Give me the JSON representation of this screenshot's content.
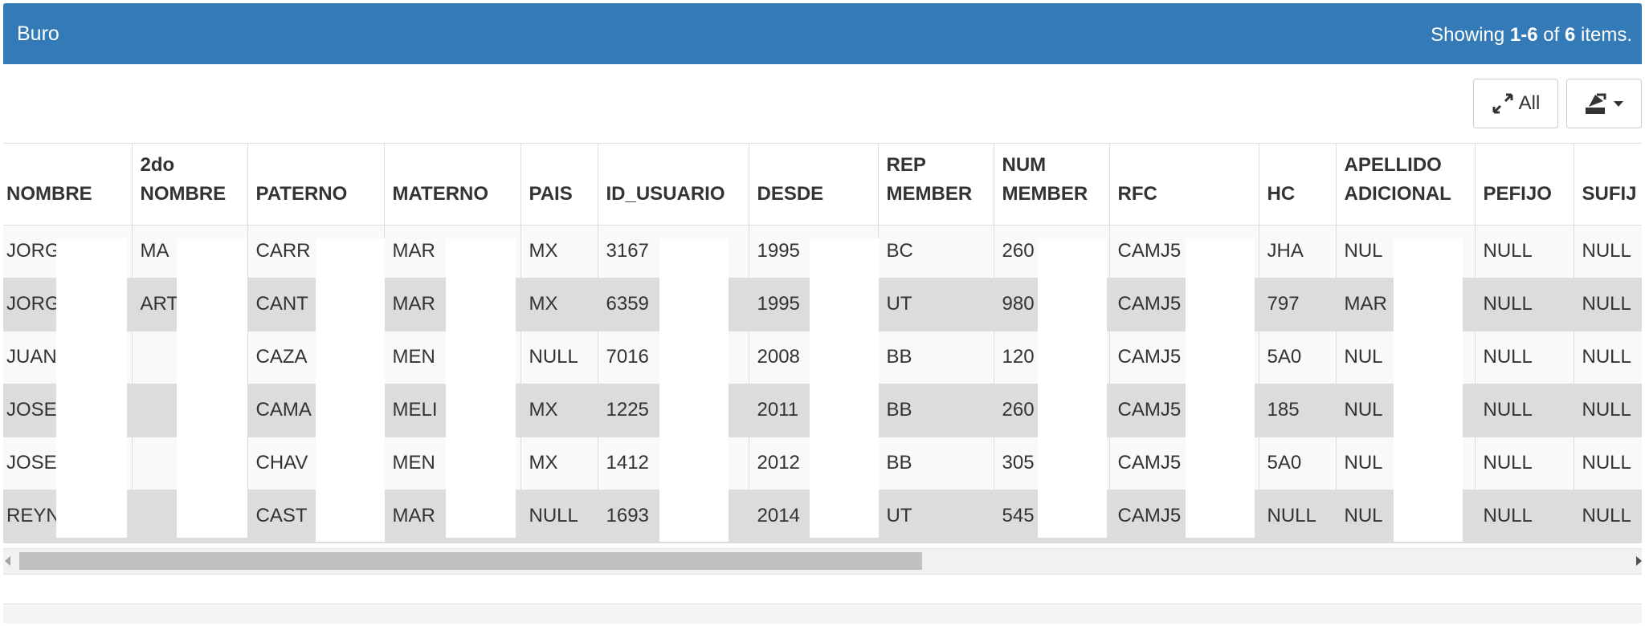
{
  "header": {
    "title": "Buro",
    "summary_prefix": "Showing ",
    "summary_range": "1-6",
    "summary_mid": " of ",
    "summary_total": "6",
    "summary_suffix": " items."
  },
  "toolbar": {
    "expand_label": "All",
    "expand_icon": "expand-arrows-icon",
    "export_icon": "export-icon",
    "export_caret_icon": "caret-down-icon"
  },
  "table": {
    "columns": [
      "NOMBRE",
      "2do NOMBRE",
      "PATERNO",
      "MATERNO",
      "PAIS",
      "ID_USUARIO",
      "DESDE",
      "REP MEMBER",
      "NUM MEMBER",
      "RFC",
      "HC",
      "APELLIDO ADICIONAL",
      "PEFIJO",
      "SUFIJ"
    ],
    "rows": [
      [
        "JORG",
        "MA",
        "CARR",
        "MAR",
        "MX",
        "3167",
        "1995",
        "BC",
        "260",
        "CAMJ5",
        "JHA",
        "NUL",
        "NULL",
        "NULL"
      ],
      [
        "JORG",
        "ART",
        "CANT",
        "MAR",
        "MX",
        "6359",
        "1995",
        "UT",
        "980",
        "CAMJ5",
        "797",
        "MAR",
        "NULL",
        "NULL"
      ],
      [
        "JUAN",
        "",
        "CAZA",
        "MEN",
        "NULL",
        "7016",
        "2008",
        "BB",
        "120",
        "CAMJ5",
        "5A0",
        "NUL",
        "NULL",
        "NULL"
      ],
      [
        "JOSE",
        "",
        "CAMA",
        "MELI",
        "MX",
        "1225",
        "2011",
        "BB",
        "260",
        "CAMJ5",
        "185",
        "NUL",
        "NULL",
        "NULL"
      ],
      [
        "JOSE",
        "",
        "CHAV",
        "MEN",
        "MX",
        "1412",
        "2012",
        "BB",
        "305",
        "CAMJ5",
        "5A0",
        "NUL",
        "NULL",
        "NULL"
      ],
      [
        "REYN",
        "",
        "CAST",
        "MAR",
        "NULL",
        "1693",
        "2014",
        "UT",
        "545",
        "CAMJ5",
        "NULL",
        "NUL",
        "NULL",
        "NULL"
      ]
    ]
  },
  "colors": {
    "header_bg": "#337ab7",
    "row_alt_bg": "#dcdcdc",
    "redaction": "#ffffff"
  }
}
